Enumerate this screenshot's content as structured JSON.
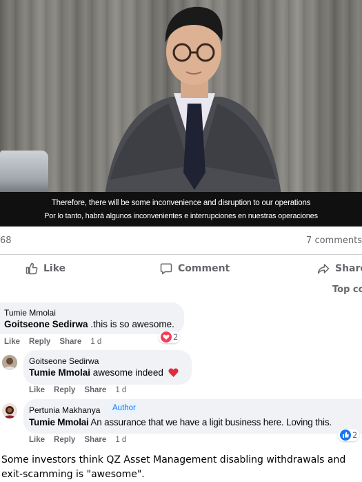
{
  "video": {
    "subtitle_en": "Therefore, there will be some inconvenience and disruption to our operations",
    "subtitle_es": "Por lo tanto, habrá algunos inconvenientes e interrupciones en nuestras operaciones"
  },
  "stats": {
    "reactions_count": "68",
    "comments_count": "7 comments"
  },
  "actions": {
    "like": "Like",
    "comment": "Comment",
    "share": "Share"
  },
  "sort_label": "Top co",
  "comments": [
    {
      "author": "Tumie Mmolai",
      "mention": "Goitseone Sedirwa",
      "text": " .this is so awesome.",
      "like": "Like",
      "reply": "Reply",
      "share": "Share",
      "time": "1 d",
      "reaction_count": "2"
    },
    {
      "author": "Goitseone Sedirwa",
      "mention": "Tumie Mmolai",
      "text": " awesome indeed",
      "like": "Like",
      "reply": "Reply",
      "share": "Share",
      "time": "1 d"
    },
    {
      "author": "Pertunia Makhanya",
      "badge": "Author",
      "mention": "Tumie Mmolai",
      "text": " An assurance that we have a ligit business here. Loving this.",
      "like": "Like",
      "reply": "Reply",
      "share": "Share",
      "time": "1 d",
      "reaction_count": "2"
    }
  ],
  "caption": "Some investors think QZ Asset Management disabling withdrawals and exit-scamming is \"awesome\".",
  "colors": {
    "facebook_blue": "#1877f2",
    "secondary_text": "#65676b",
    "bubble_bg": "#f0f2f5",
    "love_red": "#f33e58"
  }
}
